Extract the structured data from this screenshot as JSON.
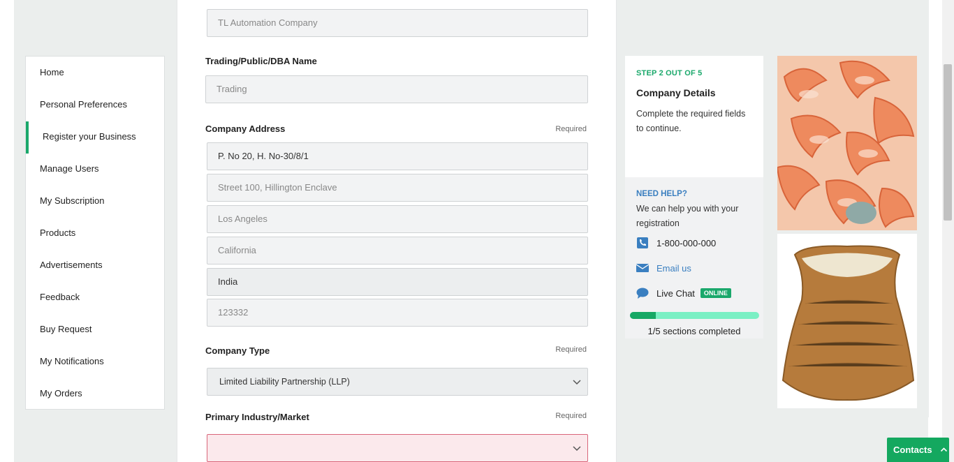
{
  "sidebar": {
    "items": [
      {
        "label": "Home"
      },
      {
        "label": "Personal Preferences"
      },
      {
        "label": "Register your Business"
      },
      {
        "label": "Manage Users"
      },
      {
        "label": "My Subscription"
      },
      {
        "label": "Products"
      },
      {
        "label": "Advertisements"
      },
      {
        "label": "Feedback"
      },
      {
        "label": "Buy Request"
      },
      {
        "label": "My Notifications"
      },
      {
        "label": "My Orders"
      }
    ],
    "active_index": 2
  },
  "form": {
    "company_name_value": "TL Automation Company",
    "trading_label": "Trading/Public/DBA Name",
    "trading_placeholder": "Trading",
    "address_label": "Company Address",
    "address_required": "Required",
    "address_line1": "P. No 20, H. No-30/8/1",
    "address_line2": "Street 100, Hillington Enclave",
    "city": "Los Angeles",
    "state": "California",
    "country": "India",
    "zip": "123332",
    "company_type_label": "Company Type",
    "company_type_required": "Required",
    "company_type_value": "Limited Liability Partnership (LLP)",
    "industry_label": "Primary Industry/Market",
    "industry_required": "Required",
    "industry_value": ""
  },
  "steps": {
    "tag": "STEP 2 OUT OF 5",
    "title": "Company Details",
    "desc": "Complete the required fields to continue.",
    "help_title": "NEED HELP?",
    "help_desc": "We can help you with your registration",
    "phone": "1-800-000-000",
    "email": "Email us",
    "chat": "Live Chat",
    "online_badge": "ONLINE",
    "progress_fraction": 0.2,
    "progress_text": "1/5 sections completed"
  },
  "contacts": {
    "label": "Contacts"
  },
  "colors": {
    "accent": "#1aa86b",
    "link": "#3a7fc0",
    "error_bg": "#fbe9ec"
  },
  "icons": [
    "phone-icon",
    "envelope-icon",
    "chat-bubble-icon",
    "chevron-down-icon",
    "chevron-up-icon"
  ]
}
